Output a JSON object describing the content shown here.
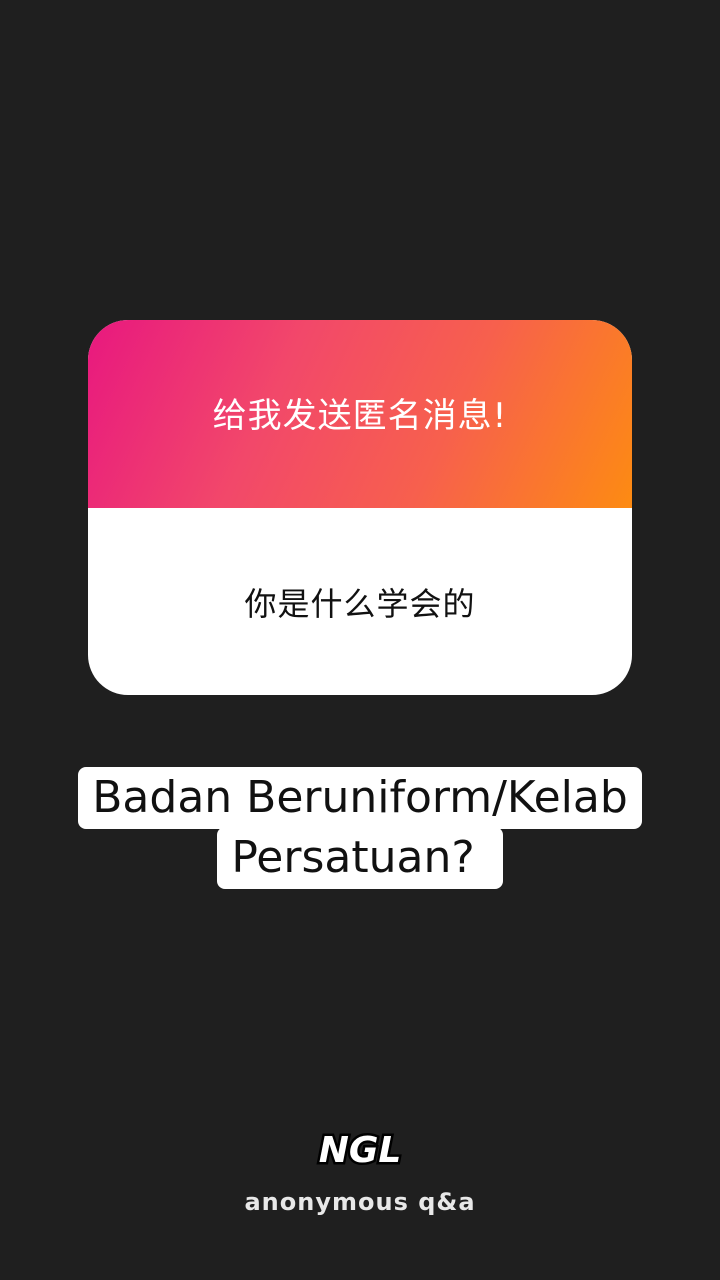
{
  "card": {
    "prompt": "给我发送匿名消息!",
    "question": "你是什么学会的"
  },
  "reply": {
    "lines": [
      "Badan Beruniform/Kelab",
      "Persatuan? "
    ]
  },
  "brand": {
    "logo_text": "NGL",
    "tagline": "anonymous q&a"
  },
  "colors": {
    "background": "#1f1f1f",
    "gradient_start": "#e8187f",
    "gradient_end": "#fd8b12"
  }
}
